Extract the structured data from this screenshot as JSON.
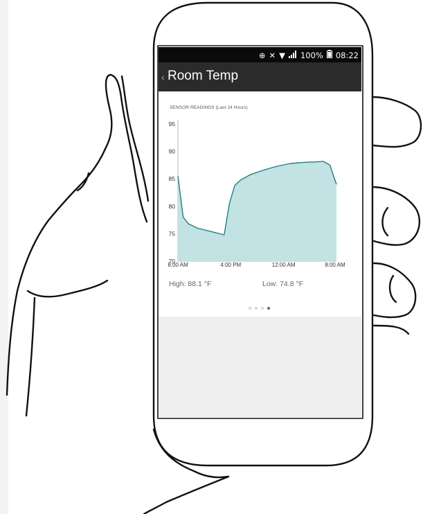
{
  "status_bar": {
    "battery_percent": "100%",
    "time": "08:22",
    "icons": [
      "data-saver-icon",
      "mute-icon",
      "wifi-icon",
      "signal-icon",
      "battery-icon"
    ]
  },
  "app_bar": {
    "back_icon": "chevron-left-icon",
    "title": "Room Temp"
  },
  "card": {
    "heading": "SENSOR READINGS (Last 24 Hours)",
    "high": "High: 88.1 °F",
    "low": "Low: 74.8 °F",
    "pagination": {
      "count": 4,
      "active_index": 3
    }
  },
  "chart_data": {
    "type": "area",
    "title": "SENSOR READINGS (Last 24 Hours)",
    "xlabel": "",
    "ylabel": "",
    "ylim": [
      70,
      95
    ],
    "yticks": [
      70,
      75,
      80,
      85,
      90,
      95
    ],
    "xticks": [
      {
        "hours": 0,
        "label": "8:00 AM"
      },
      {
        "hours": 8,
        "label": "4:00 PM"
      },
      {
        "hours": 16,
        "label": "12:00 AM"
      },
      {
        "hours": 24,
        "label": "8:00 AM"
      }
    ],
    "series": [
      {
        "color": "#1f7f80",
        "fill": "#c3e2e3",
        "points": [
          [
            0,
            85.5
          ],
          [
            0.8,
            78
          ],
          [
            1.6,
            76.8
          ],
          [
            3,
            76
          ],
          [
            5,
            75.4
          ],
          [
            7,
            74.8
          ],
          [
            7.8,
            80.5
          ],
          [
            8.6,
            83.8
          ],
          [
            9.5,
            84.8
          ],
          [
            11,
            85.8
          ],
          [
            13,
            86.6
          ],
          [
            15,
            87.3
          ],
          [
            17,
            87.8
          ],
          [
            19,
            88
          ],
          [
            21,
            88.1
          ],
          [
            22,
            88.2
          ],
          [
            23,
            87.5
          ],
          [
            24,
            84
          ]
        ]
      }
    ]
  }
}
